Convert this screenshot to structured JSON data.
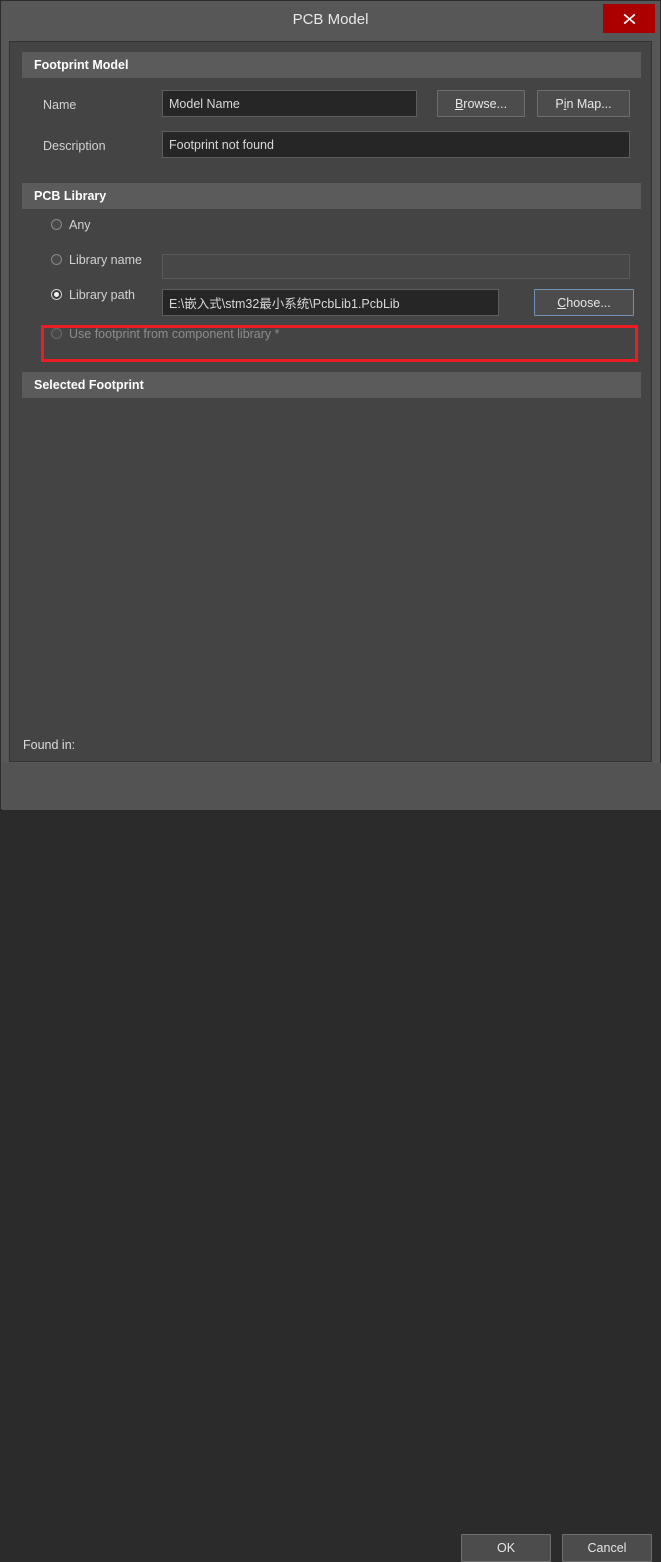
{
  "window": {
    "title": "PCB Model",
    "close_icon": "close-icon",
    "close_color": "#ab0000"
  },
  "sections": {
    "footprint_model": {
      "header": "Footprint Model",
      "name_label": "Name",
      "name_value": "Model Name",
      "description_label": "Description",
      "description_value": "Footprint not found",
      "browse_label": "Browse...",
      "browse_accel": "B",
      "pin_map_label": "Pin Map...",
      "pin_map_accel": "i"
    },
    "pcb_library": {
      "header": "PCB Library",
      "options": [
        {
          "label": "Any",
          "selected": false,
          "disabled": false
        },
        {
          "label": "Library name",
          "selected": false,
          "disabled": false
        },
        {
          "label": "Library path",
          "selected": true,
          "disabled": false
        },
        {
          "label": "Use footprint from component library *",
          "selected": false,
          "disabled": true
        }
      ],
      "library_name_value": "",
      "library_path_value": "E:\\嵌入式\\stm32最小系统\\PcbLib1.PcbLib",
      "choose_label": "Choose...",
      "choose_accel": "C"
    },
    "selected_footprint": {
      "header": "Selected Footprint",
      "preview_content": ""
    }
  },
  "status": {
    "found_in_label": "Found in:"
  },
  "footer": {
    "ok_label": "OK",
    "cancel_label": "Cancel"
  },
  "annotation": {
    "color": "#ec1c24",
    "target": "library-path-row"
  }
}
